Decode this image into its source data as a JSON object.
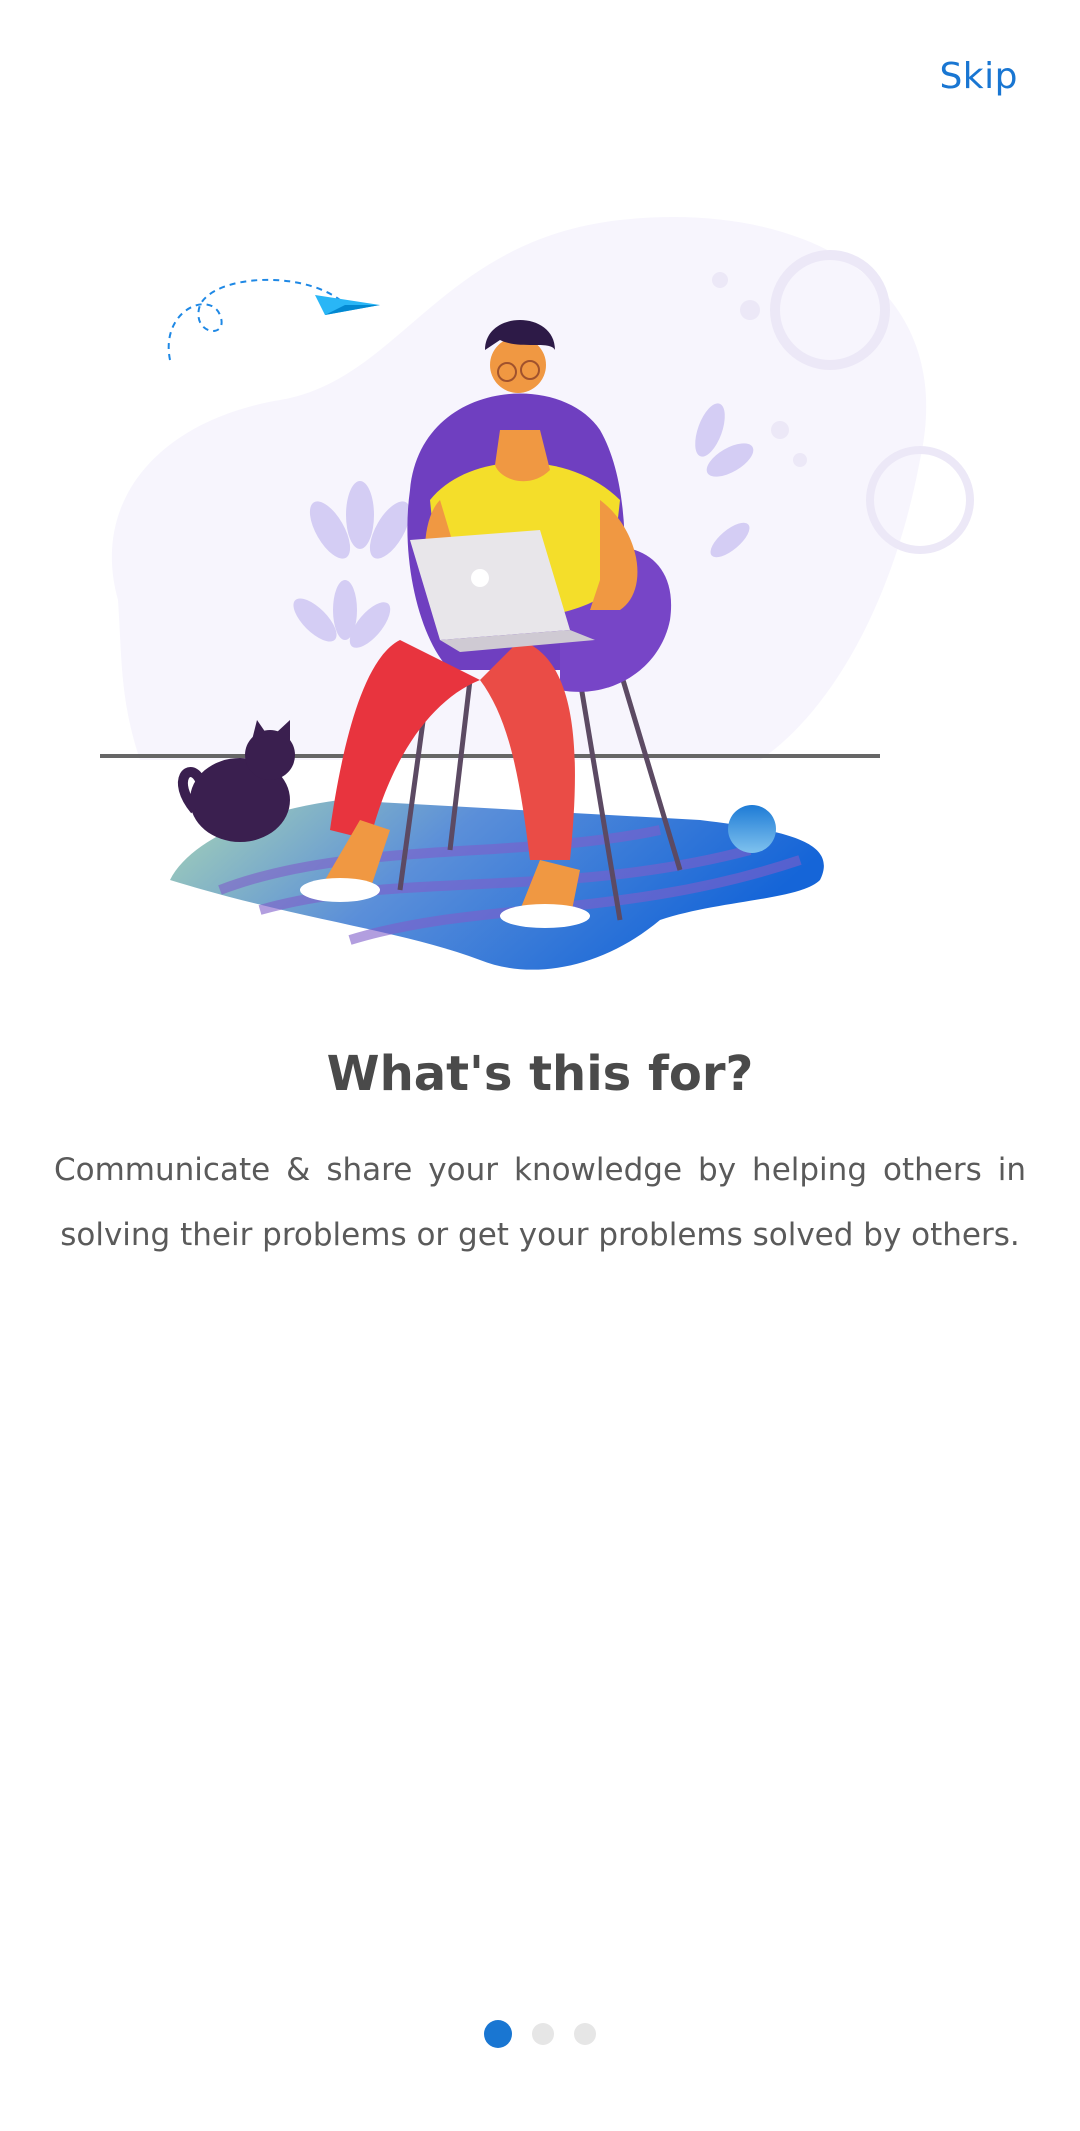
{
  "header": {
    "skip_label": "Skip"
  },
  "illustration": {
    "icon": "person-with-laptop-illustration"
  },
  "content": {
    "title": "What's this for?",
    "description": "Communicate & share your knowledge by helping others in solving their problems or get your problems solved by others."
  },
  "pager": {
    "total_pages": 3,
    "current_page": 1
  },
  "colors": {
    "accent": "#1976d2",
    "title": "#4a4a4a",
    "body_text": "#5a5a5a",
    "dot_inactive": "#e6e6e6"
  }
}
